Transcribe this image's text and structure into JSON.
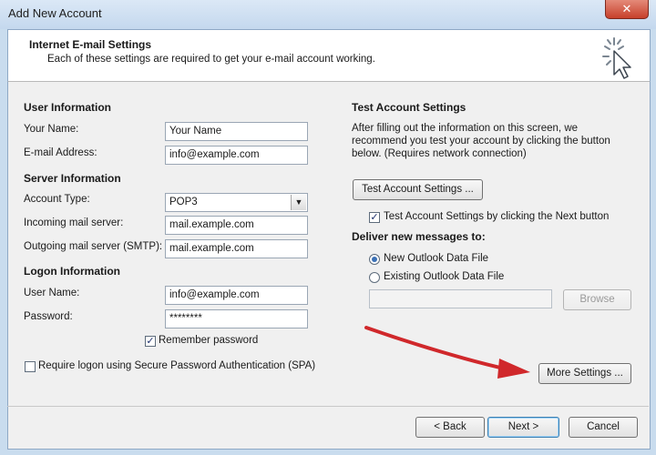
{
  "window": {
    "title": "Add New Account",
    "close_glyph": "✕"
  },
  "header": {
    "title": "Internet E-mail Settings",
    "subtitle": "Each of these settings are required to get your e-mail account working.",
    "icon": "wizard-cursor-icon"
  },
  "user_info": {
    "heading": "User Information",
    "name_label": "Your Name:",
    "name_value": "Your Name",
    "email_label": "E-mail Address:",
    "email_value": "info@example.com"
  },
  "server_info": {
    "heading": "Server Information",
    "account_type_label": "Account Type:",
    "account_type_value": "POP3",
    "incoming_label": "Incoming mail server:",
    "incoming_value": "mail.example.com",
    "outgoing_label": "Outgoing mail server (SMTP):",
    "outgoing_value": "mail.example.com"
  },
  "logon_info": {
    "heading": "Logon Information",
    "username_label": "User Name:",
    "username_value": "info@example.com",
    "password_label": "Password:",
    "password_value": "********",
    "remember_label": "Remember password",
    "remember_checked": true,
    "spa_label": "Require logon using Secure Password Authentication (SPA)",
    "spa_checked": false
  },
  "test_settings": {
    "heading": "Test Account Settings",
    "description_line1": "After filling out the information on this screen, we",
    "description_line2": "recommend you test your account by clicking the button",
    "description_line3": "below. (Requires network connection)",
    "test_button": "Test Account Settings ...",
    "auto_test_label": "Test Account Settings by clicking the Next button",
    "auto_test_checked": true
  },
  "deliver": {
    "heading": "Deliver new messages to:",
    "new_file_label": "New Outlook Data File",
    "existing_file_label": "Existing Outlook Data File",
    "selected": "new",
    "path_value": "",
    "browse_button": "Browse"
  },
  "more_settings_button": "More Settings ...",
  "footer": {
    "back_button": "< Back",
    "next_button": "Next >",
    "cancel_button": "Cancel"
  },
  "colors": {
    "arrow": "#d0282b",
    "title_bar": "#c4d8ee",
    "close_button": "#c7402b"
  }
}
